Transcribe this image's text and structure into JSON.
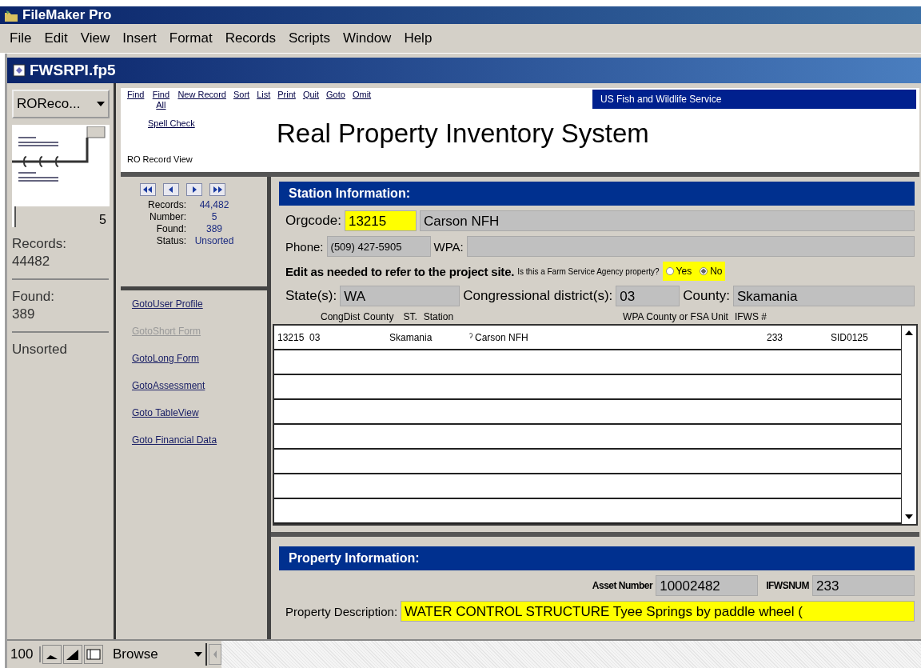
{
  "app_title": "FileMaker Pro",
  "menu": [
    "File",
    "Edit",
    "View",
    "Insert",
    "Format",
    "Records",
    "Scripts",
    "Window",
    "Help"
  ],
  "document": {
    "title": "FWSRPI.fp5"
  },
  "status_area": {
    "layout_popup": "ROReco...",
    "record_number": "5",
    "records_label": "Records:",
    "records_value": "44482",
    "found_label": "Found:",
    "found_value": "389",
    "sort_status": "Unsorted"
  },
  "toolbar_links": [
    {
      "label": "Find"
    },
    {
      "label": "Find All"
    },
    {
      "label": "New Record"
    },
    {
      "label": "Sort"
    },
    {
      "label": "List"
    },
    {
      "label": "Print"
    },
    {
      "label": "Quit"
    },
    {
      "label": "Goto"
    },
    {
      "label": "Omit"
    },
    {
      "label": "Spell Check"
    }
  ],
  "layout_name": "RO Record View",
  "banner": "US Fish and Wildlife Service",
  "system_title": "Real Property Inventory System",
  "record_stats": [
    {
      "label": "Records:",
      "value": "44,482"
    },
    {
      "label": "Number:",
      "value": "5"
    },
    {
      "label": "Found:",
      "value": "389"
    },
    {
      "label": "Status:",
      "value": "Unsorted"
    }
  ],
  "goto_links": [
    {
      "label": "GotoUser Profile",
      "disabled": false
    },
    {
      "label": "GotoShort Form",
      "disabled": true
    },
    {
      "label": "GotoLong Form",
      "disabled": false
    },
    {
      "label": "GotoAssessment",
      "disabled": false
    },
    {
      "label": "Goto TableView",
      "disabled": false
    },
    {
      "label": "Goto Financial Data",
      "disabled": false
    }
  ],
  "station": {
    "heading": "Station Information:",
    "orgcode_label": "Orgcode:",
    "orgcode": "13215",
    "station_name": "Carson NFH",
    "phone_label": "Phone:",
    "phone": "(509) 427-5905",
    "wpa_label": "WPA:",
    "note": "Edit as needed to refer to the project site.",
    "fsa_question": "Is this a Farm Service Agency property?",
    "fsa_options": [
      {
        "label": "Yes",
        "selected": false
      },
      {
        "label": "No",
        "selected": true
      }
    ],
    "state_label": "State(s):",
    "state": "WA",
    "district_label": "Congressional district(s):",
    "district": "03",
    "county_label": "County:",
    "county": "Skamania",
    "table": {
      "columns": [
        "CongDist",
        "County",
        "ST.",
        "Station",
        "WPA County or FSA Unit",
        "IFWS #"
      ],
      "rows": [
        [
          "13215",
          "03",
          "Skamania",
          "ˀ",
          "Carson NFH",
          "233",
          "SID0125"
        ]
      ]
    }
  },
  "property": {
    "heading": "Property Information:",
    "asset_label": "Asset Number",
    "asset_number": "10002482",
    "ifwsnum_label": "IFWSNUM",
    "ifwsnum": "233",
    "description_label": "Property Description:",
    "description": "WATER CONTROL STRUCTURE Tyee Springs by paddle wheel ("
  },
  "bottom_bar": {
    "zoom": "100",
    "mode": "Browse"
  }
}
